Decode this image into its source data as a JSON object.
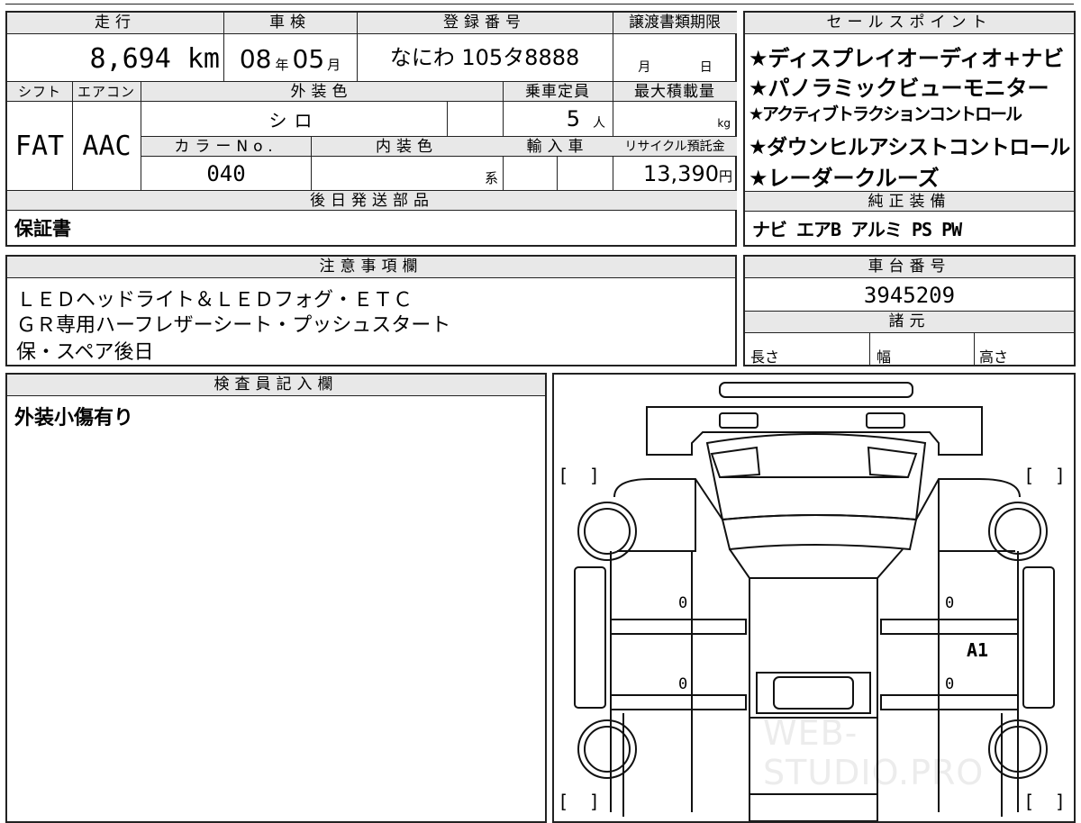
{
  "header": {
    "mileage_label": "走行",
    "inspection_label": "車検",
    "registration_label": "登録番号",
    "transfer_deadline_label": "譲渡書類期限"
  },
  "values": {
    "mileage": "8,694 km",
    "inspection_year": "08",
    "inspection_year_unit": "年",
    "inspection_month": "05",
    "inspection_month_unit": "月",
    "registration_number": "なにわ 105タ8888",
    "deadline_month_unit": "月",
    "deadline_day_unit": "日"
  },
  "row2": {
    "shift_label": "シフト",
    "aircon_label": "エアコン",
    "exterior_color_label": "外装色",
    "capacity_label": "乗車定員",
    "max_load_label": "最大積載量",
    "shift": "FAT",
    "aircon": "AAC",
    "exterior_color": "シロ",
    "capacity": "5",
    "capacity_unit": "人",
    "max_load_unit": "kg",
    "color_no_label": "カラーNo.",
    "interior_color_label": "内装色",
    "import_label": "輸入車",
    "recycle_label": "リサイクル預託金",
    "color_no": "040",
    "interior_unit": "系",
    "recycle_amount": "13,390",
    "recycle_unit": "円"
  },
  "later_parts": {
    "label": "後日発送部品",
    "value": "保証書"
  },
  "sales_points": {
    "label": "セールスポイント",
    "items": [
      "★ディスプレイオーディオ+ナビ",
      "★パノラミックビューモニター",
      "★アクティブトラクションコントロール",
      "★ダウンヒルアシストコントロール",
      "★レーダークルーズ"
    ]
  },
  "genuine_equipment": {
    "label": "純正装備",
    "value": "ナビ エアB アルミ PS PW"
  },
  "notes": {
    "label": "注意事項欄",
    "lines": [
      "ＬＥＤヘッドライト＆ＬＥＤフォグ・ＥＴＣ",
      "ＧＲ専用ハーフレザーシート・プッシュスタート",
      "保・スペア後日"
    ]
  },
  "chassis": {
    "label": "車台番号",
    "value": "3945209"
  },
  "specs": {
    "label": "諸元",
    "length_label": "長さ",
    "width_label": "幅",
    "height_label": "高さ"
  },
  "inspector": {
    "label": "検査員記入欄",
    "comment": "外装小傷有り"
  },
  "diagram": {
    "marks": [
      "0",
      "0",
      "0",
      "0"
    ],
    "damage_code": "A1",
    "bracket_open": "[",
    "bracket_close": "]"
  },
  "watermark": "WEB-STUDIO.PRO"
}
